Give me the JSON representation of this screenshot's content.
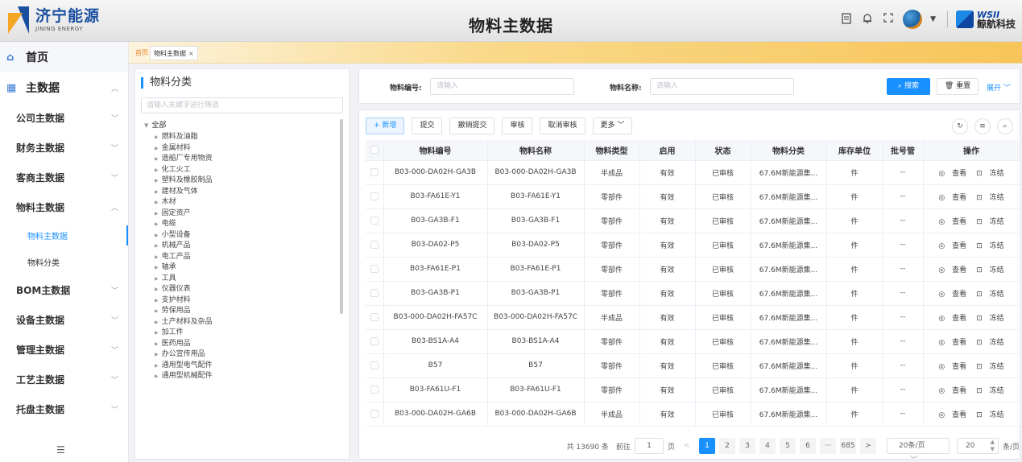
{
  "header": {
    "logo_cn": "济宁能源",
    "logo_en": "JINING ENERGY",
    "title": "物料主数据",
    "brand_en": "WSII",
    "brand_cn": "鲸航科技"
  },
  "tabs": {
    "home": "首页",
    "current": "物料主数据",
    "close": "×"
  },
  "sidebar": {
    "home": "首页",
    "group": "主数据",
    "items": [
      {
        "label": "公司主数据"
      },
      {
        "label": "财务主数据"
      },
      {
        "label": "客商主数据"
      },
      {
        "label": "物料主数据"
      }
    ],
    "sub_items": [
      {
        "label": "物料主数据"
      },
      {
        "label": "物料分类"
      }
    ],
    "items_after": [
      {
        "label": "BOM主数据"
      },
      {
        "label": "设备主数据"
      },
      {
        "label": "管理主数据"
      },
      {
        "label": "工艺主数据"
      },
      {
        "label": "托盘主数据"
      }
    ]
  },
  "category": {
    "title": "物料分类",
    "search_placeholder": "请输入关键字进行筛选",
    "root": "全部",
    "nodes": [
      "燃料及油脂",
      "金属材料",
      "造船厂专用物资",
      "化工火工",
      "塑料及橡胶制品",
      "建材及气体",
      "木材",
      "固定资产",
      "电缆",
      "小型设备",
      "机械产品",
      "电工产品",
      "轴承",
      "工具",
      "仪器仪表",
      "支护材料",
      "劳保用品",
      "土产材料及杂品",
      "加工件",
      "医药用品",
      "办公宣传用品",
      "通用型电气配件",
      "通用型机械配件"
    ]
  },
  "search": {
    "code_label": "物料编号:",
    "code_placeholder": "请输入",
    "name_label": "物料名称:",
    "name_placeholder": "请输入",
    "search_btn": "搜索",
    "reset_btn": "重置",
    "expand": "展开"
  },
  "toolbar": {
    "add": "新增",
    "submit": "提交",
    "revoke": "撤销提交",
    "audit": "审核",
    "cancel_audit": "取消审核",
    "more": "更多"
  },
  "table": {
    "headers": [
      "物料编号",
      "物料名称",
      "物料类型",
      "启用",
      "状态",
      "物料分类",
      "库存单位",
      "批号管",
      "操作"
    ],
    "action_view": "查看",
    "action_freeze": "冻结",
    "rows": [
      {
        "code": "B03-000-DA02H-GA3B",
        "name": "B03-000-DA02H-GA3B",
        "type": "半成品",
        "enabled": "有效",
        "status": "已审核",
        "category": "67.6M新能源集...",
        "unit": "件",
        "batch": "--"
      },
      {
        "code": "B03-FA61E-Y1",
        "name": "B03-FA61E-Y1",
        "type": "零部件",
        "enabled": "有效",
        "status": "已审核",
        "category": "67.6M新能源集...",
        "unit": "件",
        "batch": "--"
      },
      {
        "code": "B03-GA3B-F1",
        "name": "B03-GA3B-F1",
        "type": "零部件",
        "enabled": "有效",
        "status": "已审核",
        "category": "67.6M新能源集...",
        "unit": "件",
        "batch": "--"
      },
      {
        "code": "B03-DA02-P5",
        "name": "B03-DA02-P5",
        "type": "零部件",
        "enabled": "有效",
        "status": "已审核",
        "category": "67.6M新能源集...",
        "unit": "件",
        "batch": "--"
      },
      {
        "code": "B03-FA61E-P1",
        "name": "B03-FA61E-P1",
        "type": "零部件",
        "enabled": "有效",
        "status": "已审核",
        "category": "67.6M新能源集...",
        "unit": "件",
        "batch": "--"
      },
      {
        "code": "B03-GA3B-P1",
        "name": "B03-GA3B-P1",
        "type": "零部件",
        "enabled": "有效",
        "status": "已审核",
        "category": "67.6M新能源集...",
        "unit": "件",
        "batch": "--"
      },
      {
        "code": "B03-000-DA02H-FA57C",
        "name": "B03-000-DA02H-FA57C",
        "type": "半成品",
        "enabled": "有效",
        "status": "已审核",
        "category": "67.6M新能源集...",
        "unit": "件",
        "batch": "--"
      },
      {
        "code": "B03-BS1A-A4",
        "name": "B03-BS1A-A4",
        "type": "零部件",
        "enabled": "有效",
        "status": "已审核",
        "category": "67.6M新能源集...",
        "unit": "件",
        "batch": "--"
      },
      {
        "code": "B57",
        "name": "B57",
        "type": "零部件",
        "enabled": "有效",
        "status": "已审核",
        "category": "67.6M新能源集...",
        "unit": "件",
        "batch": "--"
      },
      {
        "code": "B03-FA61U-F1",
        "name": "B03-FA61U-F1",
        "type": "零部件",
        "enabled": "有效",
        "status": "已审核",
        "category": "67.6M新能源集...",
        "unit": "件",
        "batch": "--"
      },
      {
        "code": "B03-000-DA02H-GA6B",
        "name": "B03-000-DA02H-GA6B",
        "type": "半成品",
        "enabled": "有效",
        "status": "已审核",
        "category": "67.6M新能源集...",
        "unit": "件",
        "batch": "--"
      }
    ]
  },
  "pagination": {
    "total": "共 13690 条",
    "goto_label": "前往",
    "goto_value": "1",
    "page_unit": "页",
    "prev": "<",
    "next": ">",
    "pages": [
      "1",
      "2",
      "3",
      "4",
      "5",
      "6",
      "···",
      "685"
    ],
    "page_size": "20条/页",
    "jump_value": "20",
    "jump_unit": "条/页"
  },
  "colors": {
    "primary": "#1890ff",
    "brand_blue": "#1a4fa0",
    "brand_orange": "#f5a623"
  }
}
